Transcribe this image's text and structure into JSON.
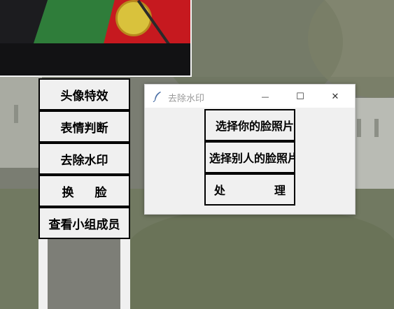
{
  "left_buttons": [
    {
      "label": "头像特效"
    },
    {
      "label": "表情判断"
    },
    {
      "label": "去除水印"
    },
    {
      "label": "换",
      "label2": "脸"
    },
    {
      "label": "查看小组成员"
    }
  ],
  "dialog": {
    "title": "去除水印",
    "buttons": [
      {
        "label": "选择你的脸照片"
      },
      {
        "label": "选择别人的脸照片"
      },
      {
        "label": "处",
        "label2": "理"
      }
    ],
    "controls": {
      "minimize": "—",
      "maximize": "☐",
      "close": "✕"
    }
  }
}
